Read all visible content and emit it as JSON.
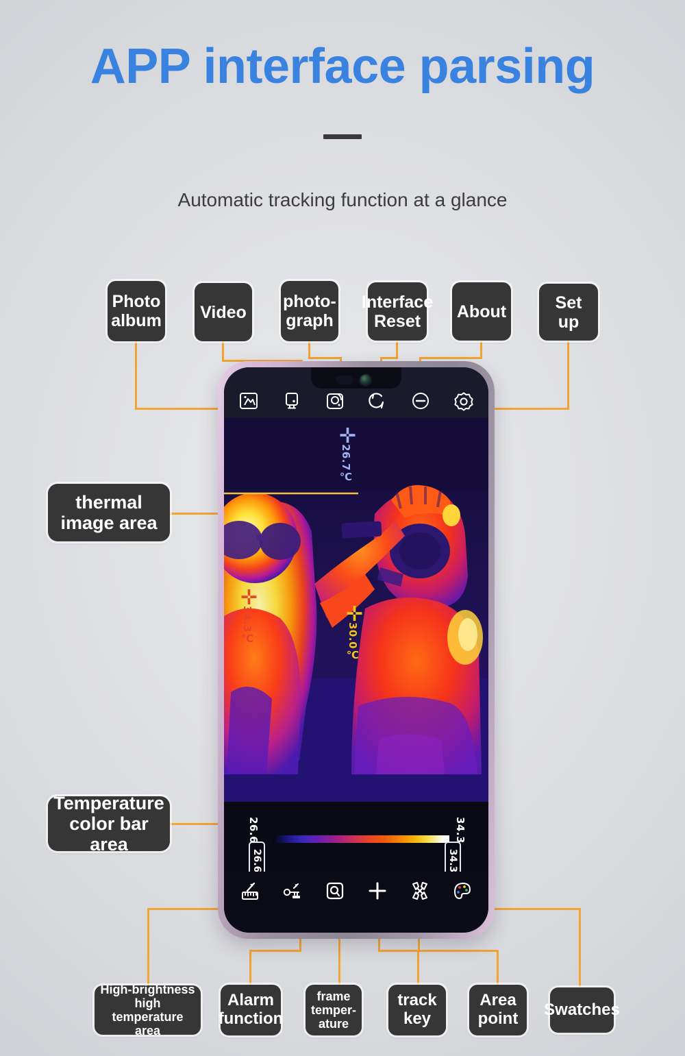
{
  "header": {
    "title": "APP interface parsing",
    "subtitle": "Automatic tracking function at a glance"
  },
  "colors": {
    "title_blue": "#3a82e0",
    "chip_bg": "#363636",
    "connector_orange": "#f2a331",
    "background": "#dedfe2",
    "phone_frame": "#d8bcd8"
  },
  "callouts": {
    "top": [
      {
        "label": "Photo\nalbum",
        "icon": "image-crop-icon"
      },
      {
        "label": "Video",
        "icon": "video-recorder-icon"
      },
      {
        "label": "photo-\ngraph",
        "icon": "camera-shutter-icon"
      },
      {
        "label": "Interface\nReset",
        "icon": "rotate-reset-icon"
      },
      {
        "label": "About",
        "icon": "minus-circle-icon"
      },
      {
        "label": "Set up",
        "icon": "gear-icon"
      }
    ],
    "left": [
      {
        "label": "thermal\nimage area"
      },
      {
        "label": "Temperature\ncolor bar area"
      }
    ],
    "bottom": [
      {
        "label": "High-brightness high\ntemperature area",
        "icon": "ruler-measure-icon"
      },
      {
        "label": "Alarm\nfunction",
        "icon": "alarm-key-icon"
      },
      {
        "label": "frame\ntemper-\nature",
        "icon": "frame-temperature-icon"
      },
      {
        "label": "track\nkey",
        "icon": "plus-track-icon"
      },
      {
        "label": "Area\npoint",
        "icon": "area-point-icon"
      },
      {
        "label": "Swatches",
        "icon": "palette-icon"
      }
    ]
  },
  "phone": {
    "toolbar_top": [
      "image-crop-icon",
      "video-recorder-icon",
      "camera-shutter-icon",
      "rotate-reset-icon",
      "minus-circle-icon",
      "gear-icon"
    ],
    "toolbar_bottom": [
      "ruler-measure-icon",
      "alarm-key-icon",
      "frame-temperature-icon",
      "plus-track-icon",
      "area-point-icon",
      "palette-icon"
    ],
    "thermal_markers": [
      {
        "value": "26.7℃",
        "color": "#9fb4f5",
        "name": "cold-spot-marker"
      },
      {
        "value": "34.3℃",
        "color": "#e8422a",
        "name": "hot-spot-marker"
      },
      {
        "value": "30.0℃",
        "color": "#f5c518",
        "name": "center-spot-marker"
      }
    ],
    "color_bar": {
      "min_label": "26.6",
      "max_label": "34.3",
      "min_handle": "26.6",
      "max_handle": "34.3"
    }
  }
}
